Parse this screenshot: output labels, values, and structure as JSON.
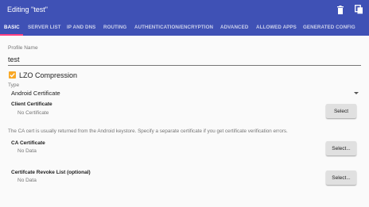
{
  "appbar": {
    "title": "Editing \"test\"",
    "delete_icon": "trash-icon",
    "copy_icon": "copy-icon"
  },
  "tabs": [
    {
      "label": "BASIC",
      "active": true
    },
    {
      "label": "SERVER LIST"
    },
    {
      "label": "IP AND DNS"
    },
    {
      "label": "ROUTING"
    },
    {
      "label": "AUTHENTICATION/ENCRYPTION"
    },
    {
      "label": "ADVANCED"
    },
    {
      "label": "ALLOWED APPS"
    },
    {
      "label": "GENERATED CONFIG"
    }
  ],
  "profile": {
    "label": "Profile Name",
    "value": "test"
  },
  "lzo": {
    "label": "LZO Compression",
    "checked": true
  },
  "type": {
    "label": "Type",
    "selected": "Android Certificate"
  },
  "client_cert": {
    "label": "Client Certificate",
    "value": "No Certificate",
    "button": "Select"
  },
  "ca_note": "The CA cert is usually returned from the Android keystore. Specify a separate certificate if you get certificate verification errors.",
  "ca_cert": {
    "label": "CA Certificate",
    "value": "No Data",
    "button": "Select..."
  },
  "crl": {
    "label": "Certifcate Revoke List (optional)",
    "value": "No Data",
    "button": "Select..."
  },
  "colors": {
    "primary": "#3f51b5",
    "indicator": "#ff4081",
    "checkbox": "#f9a825"
  }
}
